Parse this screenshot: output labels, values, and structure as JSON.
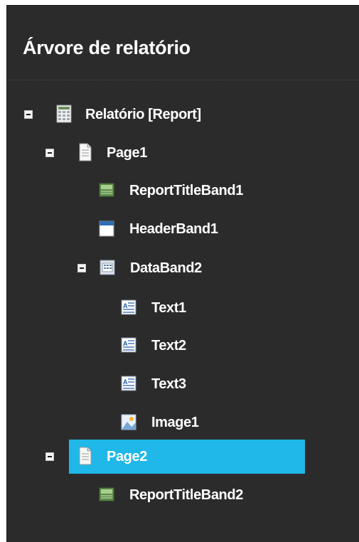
{
  "panel": {
    "title": "Árvore de relatório"
  },
  "tree": {
    "report": {
      "label": "Relatório [Report]",
      "icon": "report-icon"
    },
    "page1": {
      "label": "Page1",
      "icon": "page-icon"
    },
    "report_title_band1": {
      "label": "ReportTitleBand1",
      "icon": "report-title-band-icon"
    },
    "header_band1": {
      "label": "HeaderBand1",
      "icon": "header-band-icon"
    },
    "data_band2": {
      "label": "DataBand2",
      "icon": "data-band-icon"
    },
    "text1": {
      "label": "Text1",
      "icon": "text-object-icon"
    },
    "text2": {
      "label": "Text2",
      "icon": "text-object-icon"
    },
    "text3": {
      "label": "Text3",
      "icon": "text-object-icon"
    },
    "image1": {
      "label": "Image1",
      "icon": "image-object-icon"
    },
    "page2": {
      "label": "Page2",
      "icon": "page-icon",
      "selected": true
    },
    "report_title_band2": {
      "label": "ReportTitleBand2",
      "icon": "report-title-band-icon"
    }
  },
  "colors": {
    "panel_bg": "#2b2b2b",
    "selection": "#1fb8e8",
    "text": "#ffffff"
  }
}
